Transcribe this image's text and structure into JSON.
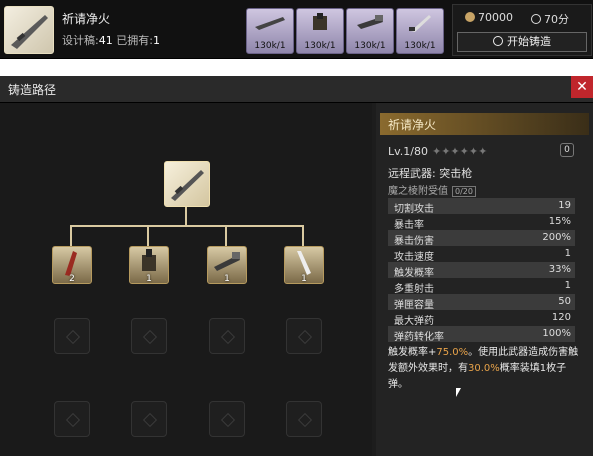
{
  "top": {
    "weapon_name": "祈请净火",
    "meta_design_label": "设计稿:",
    "meta_design_value": "41",
    "meta_owned_label": "已拥有:",
    "meta_owned_value": "1",
    "materials": [
      {
        "count": "130k/1",
        "icon": "rifle-icon"
      },
      {
        "count": "130k/1",
        "icon": "cannon-icon"
      },
      {
        "count": "130k/1",
        "icon": "gatling-icon"
      },
      {
        "count": "130k/1",
        "icon": "blade-icon"
      }
    ],
    "gold": "70000",
    "time": "70分",
    "start_button": "开始铸造"
  },
  "panel": {
    "title": "铸造路径",
    "close": "✕"
  },
  "tree": {
    "nodes": [
      {
        "count": "2",
        "icon": "red-blade-icon"
      },
      {
        "count": "1",
        "icon": "cannon-icon"
      },
      {
        "count": "1",
        "icon": "gatling-icon"
      },
      {
        "count": "1",
        "icon": "blade-icon"
      }
    ]
  },
  "info": {
    "name": "祈请净火",
    "level": "Lv.1/80",
    "stars": "✦✦✦✦✦✦",
    "level_badge": "0",
    "type": "远程武器: 突击枪",
    "affinity_label": "魔之棱附受值",
    "affinity_badge": "0/20",
    "stats": [
      {
        "k": "切割攻击",
        "v": "19"
      },
      {
        "k": "暴击率",
        "v": "15%"
      },
      {
        "k": "暴击伤害",
        "v": "200%"
      },
      {
        "k": "攻击速度",
        "v": "1"
      },
      {
        "k": "触发概率",
        "v": "33%"
      },
      {
        "k": "多重射击",
        "v": "1"
      },
      {
        "k": "弹匣容量",
        "v": "50"
      },
      {
        "k": "最大弹药",
        "v": "120"
      },
      {
        "k": "弹药转化率",
        "v": "100%"
      }
    ],
    "desc_1": "触发概率+",
    "desc_hl1": "75.0%",
    "desc_2": "。使用此武器造成伤害触发额外效果时，有",
    "desc_hl2": "30.0%",
    "desc_3": "概率装填1枚子弹。"
  }
}
